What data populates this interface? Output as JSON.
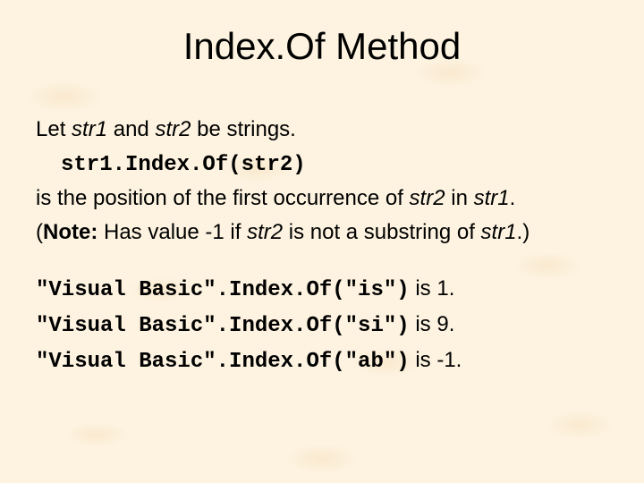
{
  "title": "Index.Of Method",
  "intro": {
    "let": "Let ",
    "s1": "str1",
    "and": " and ",
    "s2": "str2",
    "be": " be strings.",
    "call": "str1.Index.Of(str2)"
  },
  "desc": {
    "pre": "is the position of the first occurrence of ",
    "s2": "str2",
    "in": " in ",
    "s1": "str1",
    "end": "."
  },
  "note": {
    "open": "(",
    "label": "Note:",
    "pre": " Has value -1 if ",
    "s2": "str2",
    "mid": " is not a substring of ",
    "s1": "str1",
    "end": ".)"
  },
  "examples": [
    {
      "code": "\"Visual Basic\".Index.Of(\"is\")",
      "tail": " is 1."
    },
    {
      "code": "\"Visual Basic\".Index.Of(\"si\")",
      "tail": " is 9."
    },
    {
      "code": "\"Visual Basic\".Index.Of(\"ab\")",
      "tail": " is -1."
    }
  ]
}
